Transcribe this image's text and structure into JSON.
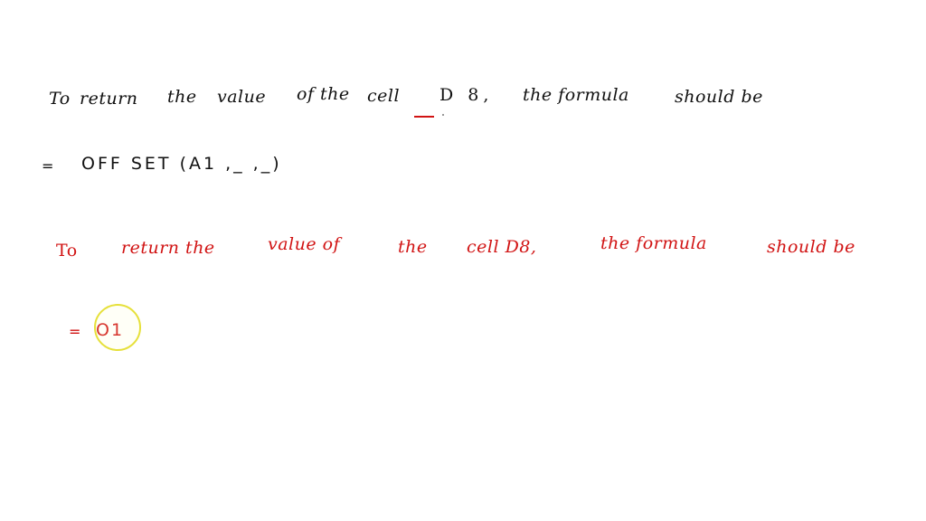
{
  "whiteboard": {
    "colors": {
      "ink_black": "#111111",
      "ink_red": "#d11313",
      "cursor_ring": "#e6e03a",
      "background": "#ffffff"
    },
    "black_section": {
      "line1_words": [
        "To",
        "return",
        "the",
        "value",
        "of the",
        "cell",
        "D 8,",
        "the formula",
        "should be"
      ],
      "formula": {
        "equals": "=",
        "text": "OFF SET (A1 ,_ ,_)"
      },
      "blank_mark": "_"
    },
    "red_section": {
      "line1_words": [
        "To",
        "return the",
        "value of",
        "the",
        "cell D8,",
        "the formula",
        "should be"
      ],
      "partial_formula": {
        "equals": "=",
        "text": "O1"
      }
    },
    "cursor": {
      "icon": "pen-cursor-highlight-ring"
    }
  }
}
